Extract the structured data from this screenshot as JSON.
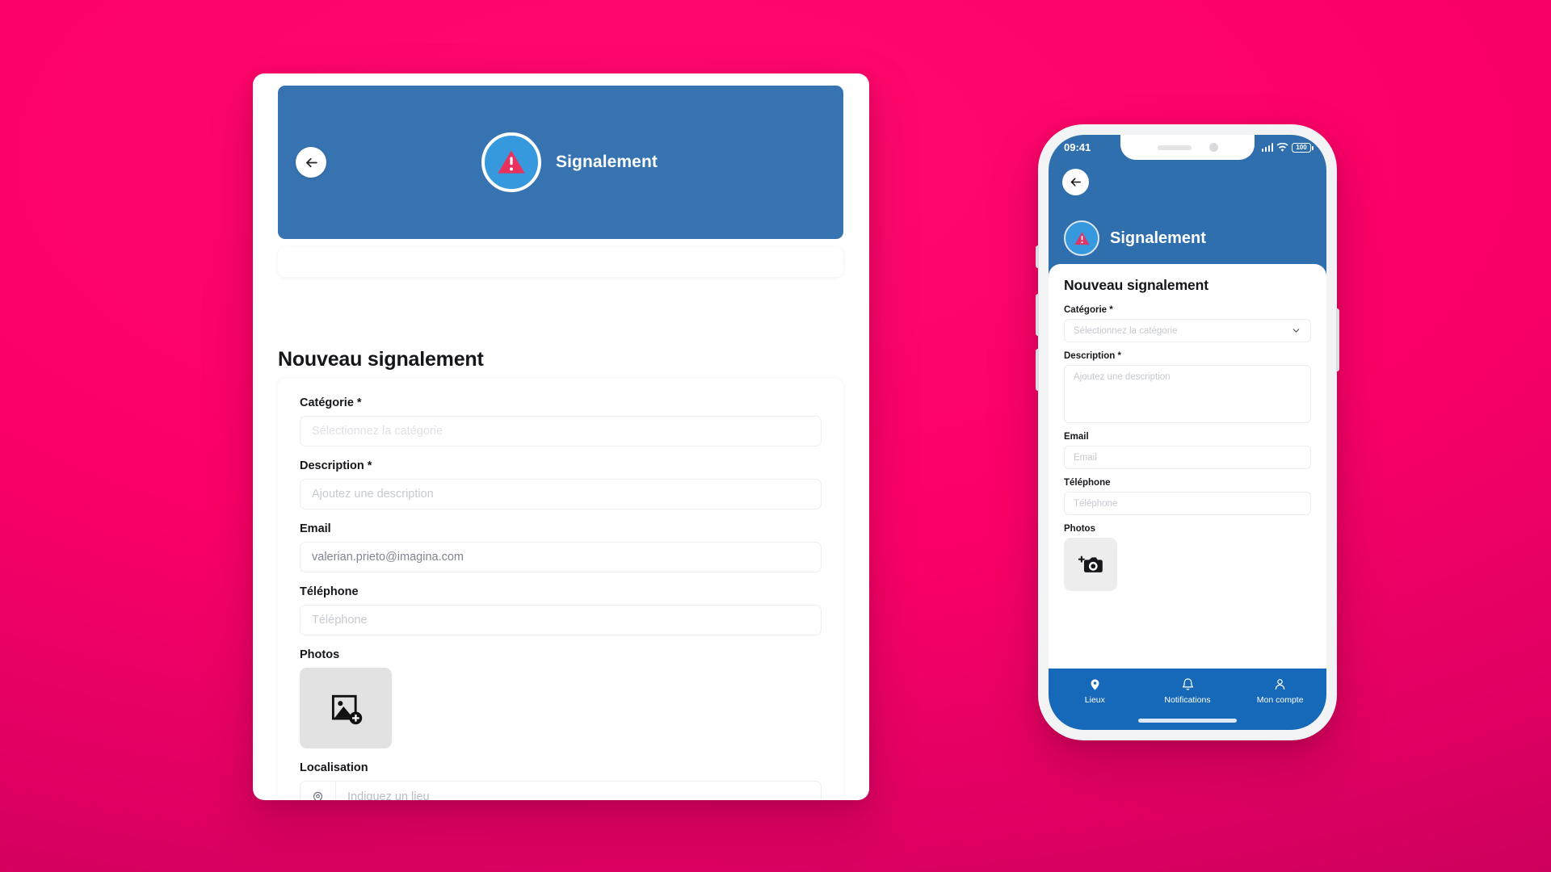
{
  "theme": {
    "background_pink": "#fb0068",
    "header_blue": "#3673b0",
    "phone_header_blue": "#2f6fad",
    "tabbar_blue": "#1668b8",
    "badge_blue": "#3699dd",
    "alert_red": "#e8315c"
  },
  "desktop": {
    "hero": {
      "back_icon": "arrow-left-icon",
      "alert_icon": "warning-triangle-icon",
      "title": "Signalement"
    },
    "page_title": "Nouveau signalement",
    "fields": {
      "category": {
        "label": "Catégorie *",
        "placeholder": "Sélectionnez la catégorie",
        "value": ""
      },
      "description": {
        "label": "Description *",
        "placeholder": "Ajoutez une description",
        "value": ""
      },
      "email": {
        "label": "Email",
        "placeholder": "Email",
        "value": "valerian.prieto@imagina.com"
      },
      "phone": {
        "label": "Téléphone",
        "placeholder": "Téléphone",
        "value": ""
      },
      "photos": {
        "label": "Photos",
        "upload_icon": "image-add-icon"
      },
      "location": {
        "label": "Localisation",
        "placeholder": "Indiquez un lieu",
        "value": "",
        "pin_icon": "map-pin-icon"
      }
    }
  },
  "phone": {
    "status_bar": {
      "time": "09:41",
      "signal_icon": "cellular-signal-icon",
      "wifi_icon": "wifi-icon",
      "battery_level": "100"
    },
    "header": {
      "back_icon": "arrow-left-icon",
      "alert_icon": "warning-triangle-icon",
      "title": "Signalement"
    },
    "page_title": "Nouveau signalement",
    "fields": {
      "category": {
        "label": "Catégorie *",
        "placeholder": "Sélectionnez la catégorie",
        "value": "",
        "chevron_icon": "chevron-down-icon"
      },
      "description": {
        "label": "Description *",
        "placeholder": "Ajoutez une description",
        "value": ""
      },
      "email": {
        "label": "Email",
        "placeholder": "Email",
        "value": ""
      },
      "phone": {
        "label": "Téléphone",
        "placeholder": "Téléphone",
        "value": ""
      },
      "photos": {
        "label": "Photos",
        "upload_icon": "camera-add-icon"
      }
    },
    "tabbar": [
      {
        "label": "Lieux",
        "icon": "map-pin-filled-icon",
        "active": true
      },
      {
        "label": "Notifications",
        "icon": "bell-icon",
        "active": false
      },
      {
        "label": "Mon compte",
        "icon": "person-icon",
        "active": false
      }
    ]
  }
}
